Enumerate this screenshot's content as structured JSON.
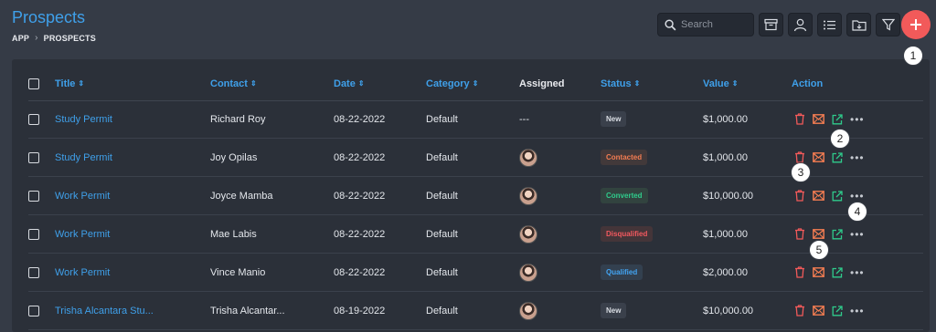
{
  "header": {
    "title": "Prospects",
    "breadcrumb": [
      "APP",
      "PROSPECTS"
    ]
  },
  "toolbar": {
    "search_placeholder": "Search",
    "icons": [
      "search-icon",
      "archive-icon",
      "user-icon",
      "list-icon",
      "download-icon",
      "filter-icon",
      "plus-icon"
    ]
  },
  "callouts": [
    "1",
    "2",
    "3",
    "4",
    "5"
  ],
  "table": {
    "columns": {
      "title": "Title",
      "contact": "Contact",
      "date": "Date",
      "category": "Category",
      "assigned": "Assigned",
      "status": "Status",
      "value": "Value",
      "action": "Action"
    },
    "sort_glyph": "⇕",
    "rows": [
      {
        "title": "Study Permit",
        "contact": "Richard Roy",
        "date": "08-22-2022",
        "category": "Default",
        "assigned": "---",
        "status": "New",
        "value": "$1,000.00"
      },
      {
        "title": "Study Permit",
        "contact": "Joy Opilas",
        "date": "08-22-2022",
        "category": "Default",
        "assigned": "",
        "status": "Contacted",
        "value": "$1,000.00"
      },
      {
        "title": "Work Permit",
        "contact": "Joyce Mamba",
        "date": "08-22-2022",
        "category": "Default",
        "assigned": "",
        "status": "Converted",
        "value": "$10,000.00"
      },
      {
        "title": "Work Permit",
        "contact": "Mae Labis",
        "date": "08-22-2022",
        "category": "Default",
        "assigned": "",
        "status": "Disqualified",
        "value": "$1,000.00"
      },
      {
        "title": "Work Permit",
        "contact": "Vince Manio",
        "date": "08-22-2022",
        "category": "Default",
        "assigned": "",
        "status": "Qualified",
        "value": "$2,000.00"
      },
      {
        "title": "Trisha Alcantara Stu...",
        "contact": "Trisha Alcantar...",
        "date": "08-19-2022",
        "category": "Default",
        "assigned": "",
        "status": "New",
        "value": "$10,000.00"
      }
    ],
    "more_glyph": "•••"
  },
  "colors": {
    "accent": "#3fa0ea",
    "add_button": "#f25a5a",
    "delete_icon": "#f25a5a",
    "email_icon": "#f47d52",
    "open_icon": "#2fcc8c"
  }
}
